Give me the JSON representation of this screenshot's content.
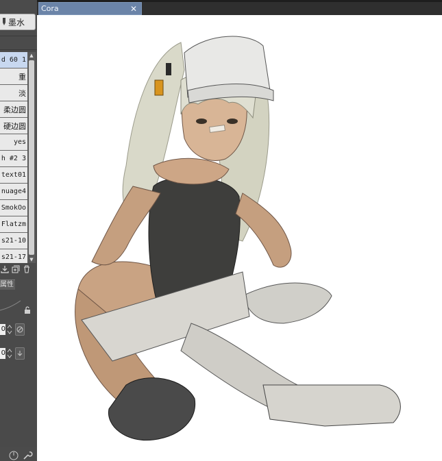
{
  "tool": {
    "label": "墨水",
    "icon": "pen-icon"
  },
  "brushes": [
    {
      "label": "d 60 1",
      "selected": true
    },
    {
      "label": "重"
    },
    {
      "label": "淡"
    },
    {
      "label": "柔边圆"
    },
    {
      "label": "硬边圆"
    },
    {
      "label": "yes"
    },
    {
      "label": "h #2 3"
    },
    {
      "label": "text01"
    },
    {
      "label": "nuage4"
    },
    {
      "label": "SmokOo"
    },
    {
      "label": "Flatzm"
    },
    {
      "label": "s21-10"
    },
    {
      "label": "s21-17"
    }
  ],
  "brush_ops": [
    "brush-import-icon",
    "brush-duplicate-icon",
    "brush-delete-icon"
  ],
  "properties": {
    "tab_label": "属性",
    "row1_value": "0",
    "row2_value": "0"
  },
  "document": {
    "tab_title": "Cora",
    "close_glyph": "✕"
  },
  "colors": {
    "panel_bg": "#4b4b4b",
    "tab_active": "#6b84a8",
    "canvas_bg": "#ffffff",
    "list_selected": "#c8d8f0"
  }
}
